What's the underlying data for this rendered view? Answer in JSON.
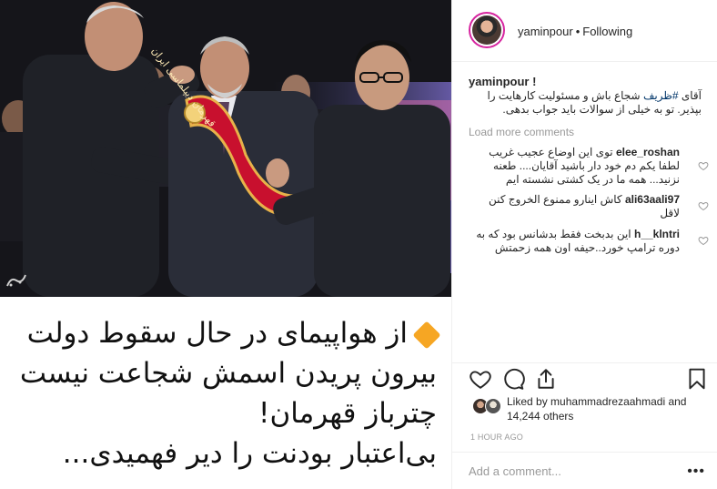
{
  "post": {
    "caption_lines": [
      "از هواپیمای در حال سقوط دولت",
      "بیرون پریدن اسمش شجاعت نیست",
      "چترباز قهرمان!",
      "بی‌اعتبار بودنت را دیر فهمیدی..."
    ],
    "sash_text": "قهرمان دیپلماسی ایران"
  },
  "header": {
    "username": "yaminpour",
    "separator": "•",
    "follow_status": "Following"
  },
  "caption": {
    "username": "yaminpour",
    "flag": "!",
    "text_before_tag": "آقای ",
    "hashtag": "#ظریف",
    "text_after_tag": " شجاع باش و مسئولیت کارهایت را بپذیر. تو به خیلی از سوالات باید جواب بدهی."
  },
  "load_more": "Load more comments",
  "comments": [
    {
      "username": "elee_roshan",
      "text": "توی این اوضاع عجیب غریب لطفا یکم دم خود دار باشید آقایان.... طعنه نزنید... همه ما در یک کشتی نشسته ایم"
    },
    {
      "username": "ali63aali97",
      "text": "کاش اینارو ممنوع الخروج کنن لاقل"
    },
    {
      "username": "h__klntri",
      "text": "این بدبخت فقط بدشانس بود که به دوره ترامپ خورد..حیفه اون همه زحمتش"
    }
  ],
  "likes": {
    "prefix": "Liked by",
    "user": "muhammadrezaahmadi",
    "conjunction": "and",
    "others": "14,244 others"
  },
  "timestamp": "1 HOUR AGO",
  "add_comment": {
    "placeholder": "Add a comment...",
    "more": "•••"
  },
  "icons": {
    "heart": "heart-icon",
    "comment": "comment-icon",
    "share": "share-icon",
    "bookmark": "bookmark-icon"
  },
  "colors": {
    "accent_orange": "#f6a623",
    "sash_red": "#c8102e",
    "link_blue": "#003569",
    "muted": "#999999"
  }
}
